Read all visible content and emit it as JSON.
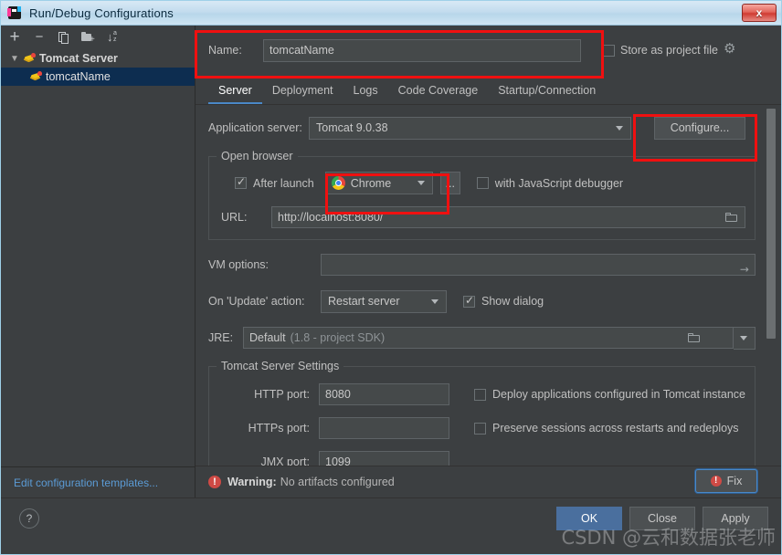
{
  "window": {
    "title": "Run/Debug Configurations",
    "close_label": "x",
    "app_icon": "intellij-icon"
  },
  "sidebar": {
    "toolbar": [
      {
        "name": "add-button",
        "glyph": "+"
      },
      {
        "name": "remove-button",
        "glyph": "−"
      },
      {
        "name": "copy-button",
        "glyph": "copy"
      },
      {
        "name": "new-folder-button",
        "glyph": "folder-plus"
      },
      {
        "name": "sort-button",
        "glyph": "sort-az"
      }
    ],
    "tree": [
      {
        "label": "Tomcat Server",
        "type": "group",
        "expanded": true,
        "selected": false
      },
      {
        "label": "tomcatName",
        "type": "item",
        "expanded": false,
        "selected": true
      }
    ],
    "edit_templates": "Edit configuration templates..."
  },
  "name_row": {
    "label": "Name:",
    "value": "tomcatName",
    "placeholder": "",
    "store_as_project_file": {
      "label": "Store as project file",
      "checked": false
    }
  },
  "tabs": [
    {
      "label": "Server",
      "active": true
    },
    {
      "label": "Deployment",
      "active": false
    },
    {
      "label": "Logs",
      "active": false
    },
    {
      "label": "Code Coverage",
      "active": false
    },
    {
      "label": "Startup/Connection",
      "active": false
    }
  ],
  "server_tab": {
    "application_server": {
      "label": "Application server:",
      "value": "Tomcat 9.0.38",
      "configure_button": "Configure..."
    },
    "open_browser": {
      "title": "Open browser",
      "after_launch": {
        "label": "After launch",
        "checked": true
      },
      "browser": "Chrome",
      "browse_button": "...",
      "js_debugger": {
        "label": "with JavaScript debugger",
        "checked": false
      },
      "url_label": "URL:",
      "url_value": "http://localhost:8080/"
    },
    "vm_options": {
      "label": "VM options:",
      "value": ""
    },
    "update_action": {
      "label": "On 'Update' action:",
      "value": "Restart server",
      "show_dialog": {
        "label": "Show dialog",
        "checked": true
      }
    },
    "jre": {
      "label": "JRE:",
      "value": "Default",
      "hint": "(1.8 - project SDK)"
    },
    "tomcat_settings": {
      "title": "Tomcat Server Settings",
      "http_port": {
        "label": "HTTP port:",
        "value": "8080"
      },
      "https_port": {
        "label": "HTTPs port:",
        "value": ""
      },
      "jmx_port": {
        "label": "JMX port:",
        "value": "1099"
      },
      "deploy_apps": {
        "label": "Deploy applications configured in Tomcat instance",
        "checked": false
      },
      "preserve_sessions": {
        "label": "Preserve sessions across restarts and redeploys",
        "checked": false
      }
    }
  },
  "warning": {
    "prefix": "Warning:",
    "message": "No artifacts configured",
    "fix_button": "Fix"
  },
  "bottom": {
    "help_label": "?",
    "ok": "OK",
    "close": "Close",
    "apply": "Apply"
  },
  "watermark": "CSDN @云和数据张老师",
  "colors": {
    "background": "#3c3f41",
    "field": "#45494a",
    "accent_blue": "#4a88c7",
    "primary_button": "#4a6f9e",
    "annotation_red": "#f01010",
    "selection": "#0d2d50",
    "link": "#5b9bd5",
    "warning_red": "#cf4a45"
  }
}
